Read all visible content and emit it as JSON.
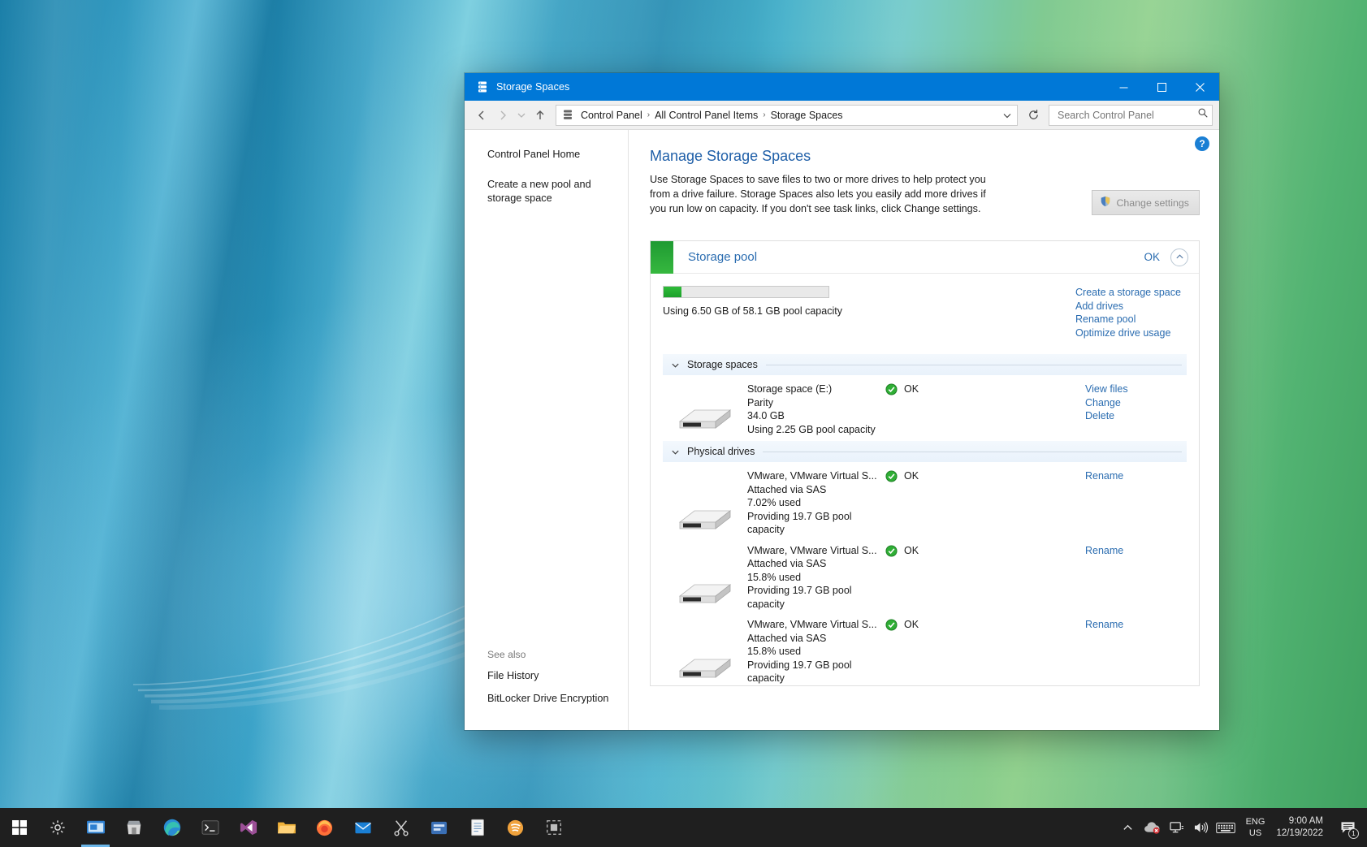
{
  "window": {
    "title": "Storage Spaces",
    "title_icon": "storage-pool-icon",
    "buttons": {
      "minimize": "minimize",
      "maximize": "maximize",
      "close": "close"
    }
  },
  "address_bar": {
    "back": "back",
    "forward": "forward",
    "recent": "recent-locations",
    "up": "up-one-level",
    "breadcrumbs": [
      "Control Panel",
      "All Control Panel Items",
      "Storage Spaces"
    ],
    "separator": "›",
    "refresh": "refresh",
    "search": {
      "placeholder": "Search Control Panel",
      "value": ""
    }
  },
  "left_pane": {
    "links": [
      "Control Panel Home",
      "Create a new pool and storage space"
    ],
    "see_also_header": "See also",
    "see_also": [
      "File History",
      "BitLocker Drive Encryption"
    ]
  },
  "main": {
    "help": "?",
    "title": "Manage Storage Spaces",
    "intro": "Use Storage Spaces to save files to two or more drives to help protect you from a drive failure. Storage Spaces also lets you easily add more drives if you run low on capacity. If you don't see task links, click Change settings.",
    "change_settings": "Change settings"
  },
  "pool": {
    "name": "Storage pool",
    "status": "OK",
    "collapse": "collapse",
    "usage_text": "Using 6.50 GB of 58.1 GB pool capacity",
    "usage_percent": 11,
    "links": [
      "Create a storage space",
      "Add drives",
      "Rename pool",
      "Optimize drive usage"
    ]
  },
  "sections": [
    {
      "label": "Storage spaces",
      "items": [
        {
          "icon": "drive-icon",
          "lines": [
            "Storage space (E:)",
            "Parity",
            "34.0 GB",
            "Using 2.25 GB pool capacity"
          ],
          "status": "OK",
          "status_icon": "ok-check-icon",
          "actions": [
            "View files",
            "Change",
            "Delete"
          ]
        }
      ]
    },
    {
      "label": "Physical drives",
      "items": [
        {
          "icon": "drive-icon",
          "lines": [
            "VMware, VMware Virtual S...",
            "Attached via SAS",
            "7.02% used",
            "Providing 19.7 GB pool capacity"
          ],
          "status": "OK",
          "status_icon": "ok-check-icon",
          "actions": [
            "Rename"
          ]
        },
        {
          "icon": "drive-icon",
          "lines": [
            "VMware, VMware Virtual S...",
            "Attached via SAS",
            "15.8% used",
            "Providing 19.7 GB pool capacity"
          ],
          "status": "OK",
          "status_icon": "ok-check-icon",
          "actions": [
            "Rename"
          ]
        },
        {
          "icon": "drive-icon",
          "lines": [
            "VMware, VMware Virtual S...",
            "Attached via SAS",
            "15.8% used",
            "Providing 19.7 GB pool capacity"
          ],
          "status": "OK",
          "status_icon": "ok-check-icon",
          "actions": [
            "Rename"
          ]
        }
      ]
    }
  ],
  "taskbar": {
    "start": "start-button",
    "items": [
      "settings-icon",
      "snip-tool-icon",
      "store-icon",
      "edge-icon",
      "terminal-icon",
      "visual-studio-icon",
      "file-explorer-icon",
      "firefox-icon",
      "mail-icon",
      "scissors-icon",
      "app-icon",
      "notepad-icon",
      "spotify-icon",
      "screenshot-icon"
    ],
    "tray": {
      "show_hidden": "show-hidden-icons",
      "onedrive": "onedrive-error-icon",
      "network": "network-icon",
      "volume": "volume-icon",
      "keyboard": "touch-keyboard-icon",
      "language_line1": "ENG",
      "language_line2": "US",
      "time": "9:00 AM",
      "date": "12/19/2022",
      "notifications": "notifications-icon",
      "notification_count": "1"
    }
  },
  "colors": {
    "title_bar": "#0078d7",
    "accent_link": "#2a6cb0",
    "pool_green": "#36b83f",
    "status_ok": "#1fa32b"
  }
}
